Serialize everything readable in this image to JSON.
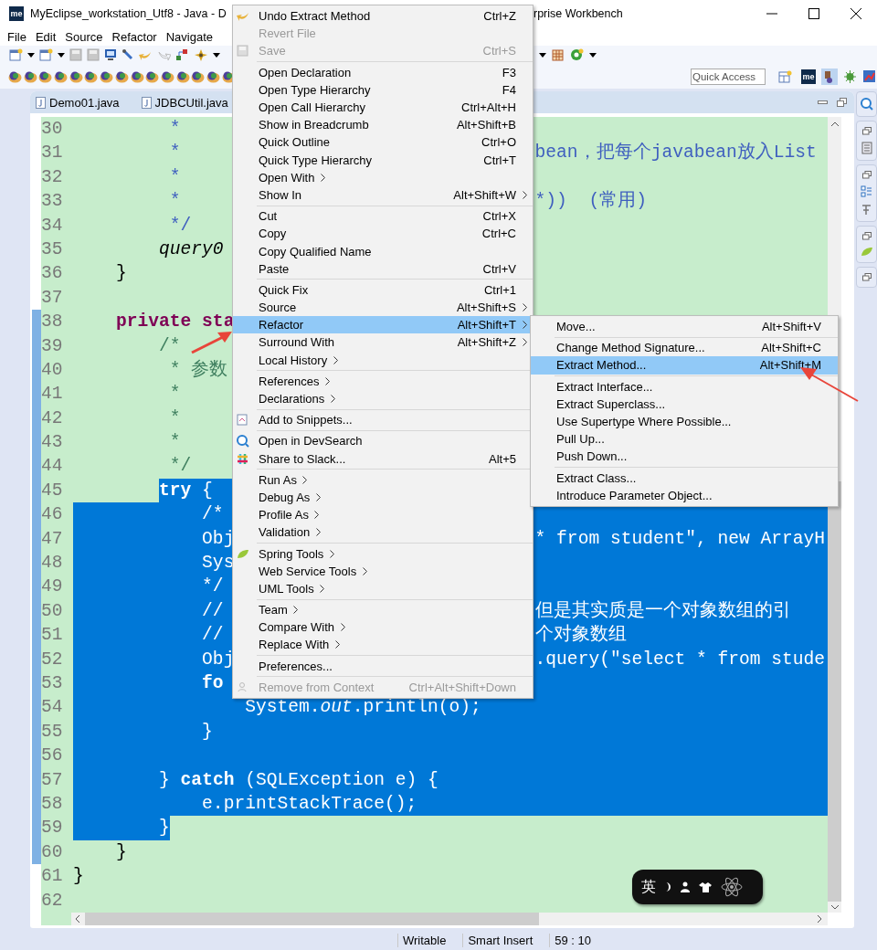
{
  "window": {
    "logo": "me",
    "title_start": "MyEclipse_workstation_Utf8 - Java - D",
    "title_end": "rprise Workbench"
  },
  "menu_bar": [
    "File",
    "Edit",
    "Source",
    "Refactor",
    "Navigate"
  ],
  "quick_access": {
    "placeholder": "Quick Access"
  },
  "perspective_logo": "me",
  "editor_tabs": [
    {
      "label": "Demo01.java",
      "selected": false
    },
    {
      "label": "JDBCUtil.java",
      "selected": false
    }
  ],
  "code_lines": [
    {
      "number": "30",
      "text": "         *",
      "kind": "javadoc",
      "selected": false,
      "marked": false
    },
    {
      "number": "31",
      "text": "         *",
      "tail": "bean，把每个javabean放入List",
      "kind": "javadoc",
      "selected": false,
      "marked": false
    },
    {
      "number": "32",
      "text": "         *",
      "kind": "javadoc",
      "selected": false,
      "marked": false
    },
    {
      "number": "33",
      "text": "         *",
      "tail": "*))  (常用)",
      "kind": "javadoc",
      "selected": false,
      "marked": false
    },
    {
      "number": "34",
      "text": "         */",
      "kind": "javadoc",
      "selected": false,
      "marked": false
    },
    {
      "number": "35",
      "text": "        query0",
      "kind": "call",
      "selected": false,
      "marked": false
    },
    {
      "number": "36",
      "text": "    }",
      "kind": "code",
      "selected": false,
      "marked": false
    },
    {
      "number": "37",
      "selected": false,
      "marked": false
    },
    {
      "number": "38",
      "text": "    private sta",
      "kind": "keyword",
      "selected": false,
      "marked": true
    },
    {
      "number": "39",
      "text": "        /*",
      "kind": "comment",
      "selected": false,
      "marked": true
    },
    {
      "number": "40",
      "text": "         * 参数",
      "kind": "comment",
      "selected": false,
      "marked": true
    },
    {
      "number": "41",
      "text": "         *",
      "kind": "comment",
      "selected": false,
      "marked": true
    },
    {
      "number": "42",
      "text": "         *",
      "kind": "comment",
      "selected": false,
      "marked": true
    },
    {
      "number": "43",
      "text": "         *",
      "kind": "comment",
      "selected": false,
      "marked": true
    },
    {
      "number": "44",
      "text": "         */",
      "kind": "comment",
      "selected": false,
      "marked": true
    },
    {
      "number": "45",
      "text": "        **try** {",
      "kind": "code",
      "selected": true,
      "selection_start": true,
      "marked": true
    },
    {
      "number": "46",
      "text": "            /*",
      "kind": "code",
      "selected": true,
      "marked": true
    },
    {
      "number": "47",
      "text": "            Obj",
      "tail": "* from student\", new ArrayH",
      "kind": "code",
      "selected": true,
      "marked": true
    },
    {
      "number": "48",
      "text": "            Sys",
      "kind": "code",
      "selected": true,
      "marked": true
    },
    {
      "number": "49",
      "text": "            */",
      "kind": "code",
      "selected": true,
      "marked": true
    },
    {
      "number": "50",
      "text": "            //",
      "tail": "但是其实质是一个对象数组的引",
      "kind": "code",
      "selected": true,
      "marked": true
    },
    {
      "number": "51",
      "text": "            //",
      "tail": "个对象数组",
      "kind": "code",
      "selected": true,
      "marked": true
    },
    {
      "number": "52",
      "text": "            Obj",
      "tail": ".query(\"select * from stude",
      "kind": "code",
      "selected": true,
      "marked": true
    },
    {
      "number": "53",
      "text": "            fo",
      "kind": "keyword",
      "selected": true,
      "marked": true
    },
    {
      "number": "54",
      "text": "                System.*out*.println(o);",
      "kind": "code",
      "selected": true,
      "marked": true
    },
    {
      "number": "55",
      "text": "            }",
      "kind": "code",
      "selected": true,
      "marked": true
    },
    {
      "number": "56",
      "selected": true,
      "marked": true
    },
    {
      "number": "57",
      "text": "        } **catch** (SQLException e) {",
      "kind": "code",
      "selected": true,
      "marked": true
    },
    {
      "number": "58",
      "text": "            e.printStackTrace();",
      "kind": "code",
      "selected": true,
      "marked": true
    },
    {
      "number": "59",
      "text": "        }",
      "kind": "code",
      "selected": true,
      "selection_end": true,
      "marked": true
    },
    {
      "number": "60",
      "text": "    }",
      "kind": "code",
      "selected": false,
      "marked": true
    },
    {
      "number": "61",
      "text": "}",
      "kind": "code",
      "selected": false,
      "marked": false
    },
    {
      "number": "62",
      "selected": false,
      "marked": false
    }
  ],
  "context_menu": [
    {
      "kind": "item",
      "label": "Undo Extract Method",
      "shortcut": "Ctrl+Z",
      "disabled": false,
      "submenu": false,
      "selected": false
    },
    {
      "kind": "item",
      "label": "Revert File",
      "disabled": true,
      "submenu": false,
      "selected": false
    },
    {
      "kind": "item",
      "label": "Save",
      "shortcut": "Ctrl+S",
      "disabled": true,
      "submenu": false,
      "selected": false
    },
    {
      "kind": "separator"
    },
    {
      "kind": "item",
      "label": "Open Declaration",
      "shortcut": "F3",
      "disabled": false,
      "submenu": false,
      "selected": false
    },
    {
      "kind": "item",
      "label": "Open Type Hierarchy",
      "shortcut": "F4",
      "disabled": false,
      "submenu": false,
      "selected": false
    },
    {
      "kind": "item",
      "label": "Open Call Hierarchy",
      "shortcut": "Ctrl+Alt+H",
      "disabled": false,
      "submenu": false,
      "selected": false
    },
    {
      "kind": "item",
      "label": "Show in Breadcrumb",
      "shortcut": "Alt+Shift+B",
      "disabled": false,
      "submenu": false,
      "selected": false
    },
    {
      "kind": "item",
      "label": "Quick Outline",
      "shortcut": "Ctrl+O",
      "disabled": false,
      "submenu": false,
      "selected": false
    },
    {
      "kind": "item",
      "label": "Quick Type Hierarchy",
      "shortcut": "Ctrl+T",
      "disabled": false,
      "submenu": false,
      "selected": false
    },
    {
      "kind": "item",
      "label": "Open With",
      "disabled": false,
      "submenu": true,
      "selected": false
    },
    {
      "kind": "item",
      "label": "Show In",
      "shortcut": "Alt+Shift+W",
      "disabled": false,
      "submenu": true,
      "selected": false
    },
    {
      "kind": "separator"
    },
    {
      "kind": "item",
      "label": "Cut",
      "shortcut": "Ctrl+X",
      "disabled": false,
      "submenu": false,
      "selected": false
    },
    {
      "kind": "item",
      "label": "Copy",
      "shortcut": "Ctrl+C",
      "disabled": false,
      "submenu": false,
      "selected": false
    },
    {
      "kind": "item",
      "label": "Copy Qualified Name",
      "disabled": false,
      "submenu": false,
      "selected": false
    },
    {
      "kind": "item",
      "label": "Paste",
      "shortcut": "Ctrl+V",
      "disabled": false,
      "submenu": false,
      "selected": false
    },
    {
      "kind": "separator"
    },
    {
      "kind": "item",
      "label": "Quick Fix",
      "shortcut": "Ctrl+1",
      "disabled": false,
      "submenu": false,
      "selected": false
    },
    {
      "kind": "item",
      "label": "Source",
      "shortcut": "Alt+Shift+S",
      "disabled": false,
      "submenu": true,
      "selected": false
    },
    {
      "kind": "item",
      "label": "Refactor",
      "shortcut": "Alt+Shift+T",
      "disabled": false,
      "submenu": true,
      "selected": true
    },
    {
      "kind": "item",
      "label": "Surround With",
      "shortcut": "Alt+Shift+Z",
      "disabled": false,
      "submenu": true,
      "selected": false
    },
    {
      "kind": "item",
      "label": "Local History",
      "disabled": false,
      "submenu": true,
      "selected": false
    },
    {
      "kind": "separator"
    },
    {
      "kind": "item",
      "label": "References",
      "disabled": false,
      "submenu": true,
      "selected": false
    },
    {
      "kind": "item",
      "label": "Declarations",
      "disabled": false,
      "submenu": true,
      "selected": false
    },
    {
      "kind": "separator"
    },
    {
      "kind": "item",
      "label": "Add to Snippets...",
      "disabled": false,
      "submenu": false,
      "selected": false
    },
    {
      "kind": "separator"
    },
    {
      "kind": "item",
      "label": "Open in DevSearch",
      "disabled": false,
      "submenu": false,
      "selected": false
    },
    {
      "kind": "item",
      "label": "Share to Slack...",
      "shortcut": "Alt+5",
      "disabled": false,
      "submenu": false,
      "selected": false
    },
    {
      "kind": "separator"
    },
    {
      "kind": "item",
      "label": "Run As",
      "disabled": false,
      "submenu": true,
      "selected": false
    },
    {
      "kind": "item",
      "label": "Debug As",
      "disabled": false,
      "submenu": true,
      "selected": false
    },
    {
      "kind": "item",
      "label": "Profile As",
      "disabled": false,
      "submenu": true,
      "selected": false
    },
    {
      "kind": "item",
      "label": "Validation",
      "disabled": false,
      "submenu": true,
      "selected": false
    },
    {
      "kind": "separator"
    },
    {
      "kind": "item",
      "label": "Spring Tools",
      "disabled": false,
      "submenu": true,
      "selected": false
    },
    {
      "kind": "item",
      "label": "Web Service Tools",
      "disabled": false,
      "submenu": true,
      "selected": false
    },
    {
      "kind": "item",
      "label": "UML Tools",
      "disabled": false,
      "submenu": true,
      "selected": false
    },
    {
      "kind": "separator"
    },
    {
      "kind": "item",
      "label": "Team",
      "disabled": false,
      "submenu": true,
      "selected": false
    },
    {
      "kind": "item",
      "label": "Compare With",
      "disabled": false,
      "submenu": true,
      "selected": false
    },
    {
      "kind": "item",
      "label": "Replace With",
      "disabled": false,
      "submenu": true,
      "selected": false
    },
    {
      "kind": "separator"
    },
    {
      "kind": "item",
      "label": "Preferences...",
      "disabled": false,
      "submenu": false,
      "selected": false
    },
    {
      "kind": "separator"
    },
    {
      "kind": "item",
      "label": "Remove from Context",
      "shortcut": "Ctrl+Alt+Shift+Down",
      "disabled": true,
      "submenu": false,
      "selected": false
    }
  ],
  "refactor_submenu": [
    {
      "kind": "item",
      "label": "Move...",
      "shortcut": "Alt+Shift+V",
      "selected": false
    },
    {
      "kind": "separator"
    },
    {
      "kind": "item",
      "label": "Change Method Signature...",
      "shortcut": "Alt+Shift+C",
      "selected": false
    },
    {
      "kind": "item",
      "label": "Extract Method...",
      "shortcut": "Alt+Shift+M",
      "selected": true
    },
    {
      "kind": "separator"
    },
    {
      "kind": "item",
      "label": "Extract Interface...",
      "selected": false
    },
    {
      "kind": "item",
      "label": "Extract Superclass...",
      "selected": false
    },
    {
      "kind": "item",
      "label": "Use Supertype Where Possible...",
      "selected": false
    },
    {
      "kind": "item",
      "label": "Pull Up...",
      "selected": false
    },
    {
      "kind": "item",
      "label": "Push Down...",
      "selected": false
    },
    {
      "kind": "separator"
    },
    {
      "kind": "item",
      "label": "Extract Class...",
      "selected": false
    },
    {
      "kind": "item",
      "label": "Introduce Parameter Object...",
      "selected": false
    }
  ],
  "ime_toolbar": {
    "mode": "英"
  },
  "status_bar": [
    "Writable",
    "Smart Insert",
    "59 : 10"
  ]
}
